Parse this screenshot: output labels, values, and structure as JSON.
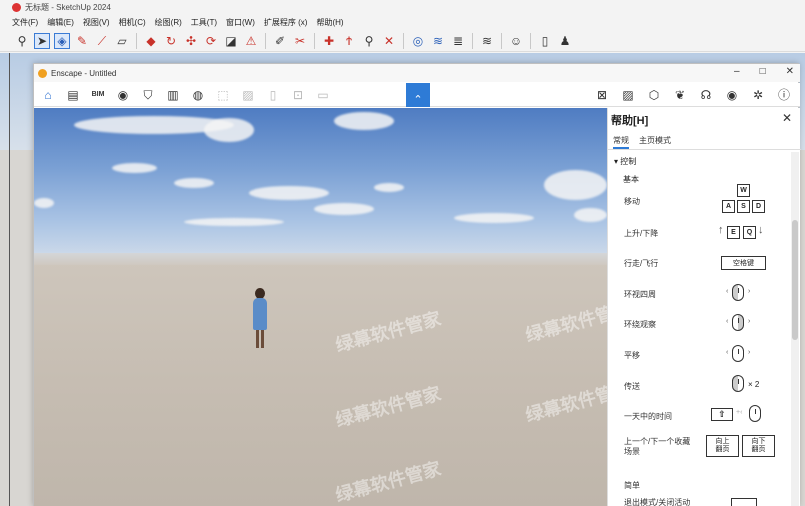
{
  "sketchup": {
    "title": "无标题 - SketchUp 2024",
    "menu": [
      "文件(F)",
      "编辑(E)",
      "视图(V)",
      "相机(C)",
      "绘图(R)",
      "工具(T)",
      "窗口(W)",
      "扩展程序 (x)",
      "帮助(H)"
    ],
    "toolbar_icons": [
      "search-icon",
      "select-arrow-icon",
      "eraser-icon",
      "pencil-icon",
      "line-icon",
      "rect-icon",
      "push-pull-icon",
      "rotate-icon",
      "move-icon",
      "refresh-icon",
      "scale-icon",
      "offset-icon",
      "paint-icon",
      "tape-icon",
      "section-icon",
      "text-icon",
      "magnifier-icon",
      "zoom-extents-icon",
      "orbit-icon",
      "pan-icon",
      "layer-icon",
      "stack-icon",
      "user-circle-icon",
      "page-icon",
      "person-icon"
    ]
  },
  "enscape": {
    "title": "Enscape - Untitled",
    "window_controls": {
      "minimize": "–",
      "maximize": "□",
      "close": "✕"
    },
    "toolbar_icons": [
      "home-icon",
      "doc-icon",
      "bim-icon",
      "view-icon",
      "shield-icon",
      "building-icon",
      "globe-icon",
      "frame-icon",
      "image-icon",
      "file-icon",
      "vr-icon",
      "export-icon"
    ],
    "bim_label": "BIM",
    "collapse_glyph": "⌃",
    "right_toolbar_icons": [
      "render-icon",
      "screenshot-icon",
      "cube-icon",
      "leaf-icon",
      "headset-icon",
      "eye-icon",
      "settings-icon",
      "help-icon"
    ],
    "watermark_text": "绿幕软件管家"
  },
  "help_panel": {
    "title": "帮助[H]",
    "close_glyph": "✕",
    "tabs": [
      "常规",
      "主页模式"
    ],
    "active_tab": "常规",
    "section": "控制",
    "subsection": "基本",
    "rows": [
      {
        "label": "移动",
        "keys": [
          "W",
          "A",
          "S",
          "D"
        ]
      },
      {
        "label": "上升/下降",
        "keys": [
          "E",
          "Q"
        ]
      },
      {
        "label": "行走/飞行",
        "keys": [
          "空格键"
        ]
      },
      {
        "label": "环视四周",
        "keys": []
      },
      {
        "label": "环绕观察",
        "keys": []
      },
      {
        "label": "平移",
        "keys": []
      },
      {
        "label": "传送",
        "keys": [
          "× 2"
        ]
      },
      {
        "label": "一天中的时间",
        "keys": []
      },
      {
        "label": "上一个/下一个收藏\n场景",
        "keys": [
          "向上\n翻页",
          "向下\n翻页"
        ]
      }
    ],
    "footer_section": "简单",
    "footer_row": "退出模式/关闭活动"
  }
}
